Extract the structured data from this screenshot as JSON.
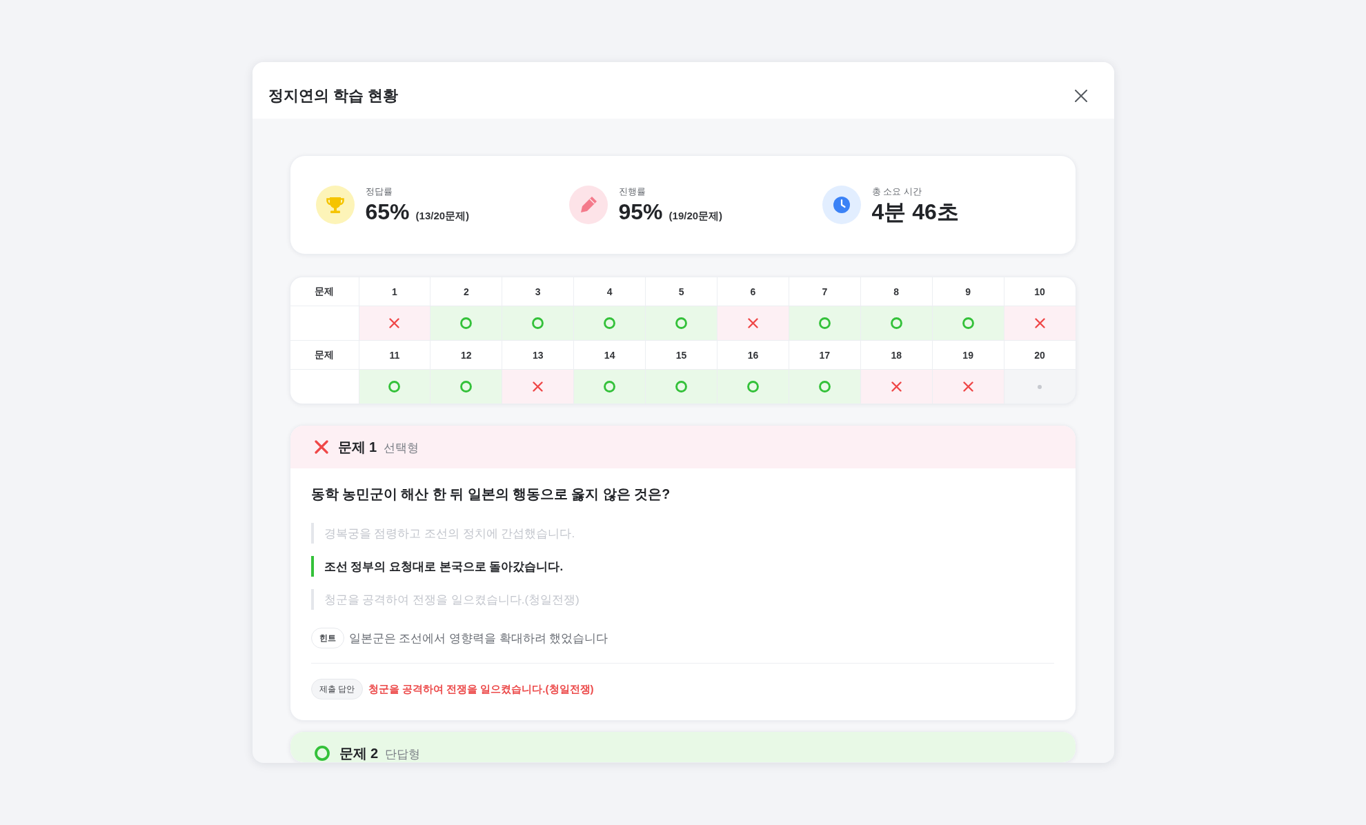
{
  "modal": {
    "title": "정지연의 학습 현황"
  },
  "stats": [
    {
      "kind": "accuracy",
      "label": "정답률",
      "value": "65%",
      "detail": "(13/20문제)"
    },
    {
      "kind": "progress",
      "label": "진행률",
      "value": "95%",
      "detail": "(19/20문제)"
    },
    {
      "kind": "time",
      "label": "총 소요 시간",
      "value": "4분 46초"
    }
  ],
  "result_grid": {
    "rows": [
      {
        "label": "문제",
        "items": [
          {
            "number": "1",
            "kind": "wrong"
          },
          {
            "number": "2",
            "kind": "correct"
          },
          {
            "number": "3",
            "kind": "correct"
          },
          {
            "number": "4",
            "kind": "correct"
          },
          {
            "number": "5",
            "kind": "correct"
          },
          {
            "number": "6",
            "kind": "wrong"
          },
          {
            "number": "7",
            "kind": "correct"
          },
          {
            "number": "8",
            "kind": "correct"
          },
          {
            "number": "9",
            "kind": "correct"
          },
          {
            "number": "10",
            "kind": "wrong"
          }
        ]
      },
      {
        "label": "문제",
        "items": [
          {
            "number": "11",
            "kind": "correct"
          },
          {
            "number": "12",
            "kind": "correct"
          },
          {
            "number": "13",
            "kind": "wrong"
          },
          {
            "number": "14",
            "kind": "correct"
          },
          {
            "number": "15",
            "kind": "correct"
          },
          {
            "number": "16",
            "kind": "correct"
          },
          {
            "number": "17",
            "kind": "correct"
          },
          {
            "number": "18",
            "kind": "wrong"
          },
          {
            "number": "19",
            "kind": "wrong"
          },
          {
            "number": "20",
            "kind": "pending"
          }
        ]
      }
    ]
  },
  "questions": [
    {
      "correct": false,
      "title": "문제 1",
      "type": "선택형",
      "text": "동학 농민군이 해산 한 뒤 일본의 행동으로 옳지 않은 것은?",
      "options": [
        {
          "text": "경복궁을 점령하고 조선의 정치에 간섭했습니다.",
          "correct": false
        },
        {
          "text": "조선 정부의 요청대로 본국으로 돌아갔습니다.",
          "correct": true
        },
        {
          "text": "청군을 공격하여 전쟁을 일으켰습니다.(청일전쟁)",
          "correct": false
        }
      ],
      "hint_label": "힌트",
      "hint": "일본군은 조선에서 영향력을 확대하려 했었습니다",
      "answer_label": "제출 답안",
      "answer": "청군을 공격하여 전쟁을 일으켰습니다.(청일전쟁)"
    },
    {
      "correct": true,
      "title": "문제 2",
      "type": "단답형"
    }
  ]
}
